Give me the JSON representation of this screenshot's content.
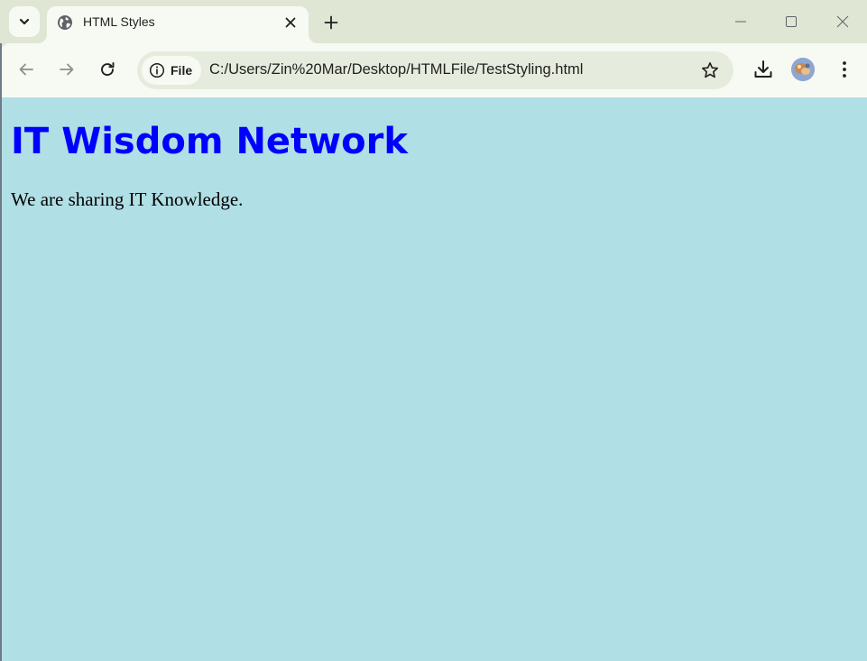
{
  "browser": {
    "tab": {
      "title": "HTML Styles"
    },
    "address_bar": {
      "site_chip_label": "File",
      "url": "C:/Users/Zin%20Mar/Desktop/HTMLFile/TestStyling.html"
    },
    "icons": {
      "tab_search": "chevron-down-icon",
      "favicon": "globe-icon",
      "tab_close": "close-icon",
      "new_tab": "plus-icon",
      "minimize": "minimize-icon",
      "maximize": "maximize-icon",
      "close_window": "close-icon",
      "back": "arrow-left-icon",
      "forward": "arrow-right-icon",
      "reload": "reload-icon",
      "site_info": "info-icon",
      "bookmark": "star-icon",
      "download": "download-icon",
      "menu": "kebab-menu-icon"
    },
    "colors": {
      "frame": "#dfe6d4",
      "toolbar": "#f7faf2",
      "omnibox": "#e6ecdd"
    }
  },
  "page": {
    "heading": "IT Wisdom Network",
    "paragraph": "We are sharing IT Knowledge.",
    "colors": {
      "background": "#b0dfe5",
      "heading": "#0000ff",
      "paragraph": "#000000"
    }
  }
}
